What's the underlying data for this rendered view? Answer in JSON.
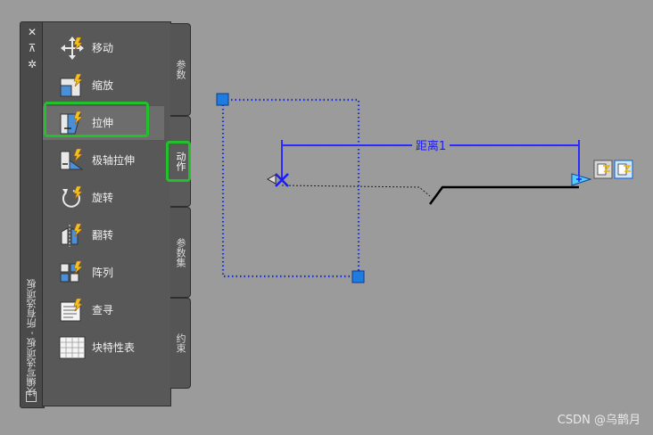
{
  "palette": {
    "title": "块编写选项板 - 所有选项板",
    "close_label": "✕",
    "pin_label": "⊼",
    "props_label": "✲",
    "tools": [
      {
        "label": "移动",
        "icon": "move-icon"
      },
      {
        "label": "缩放",
        "icon": "scale-icon"
      },
      {
        "label": "拉伸",
        "icon": "stretch-icon"
      },
      {
        "label": "极轴拉伸",
        "icon": "polar-stretch-icon"
      },
      {
        "label": "旋转",
        "icon": "rotate-icon"
      },
      {
        "label": "翻转",
        "icon": "flip-icon"
      },
      {
        "label": "阵列",
        "icon": "array-icon"
      },
      {
        "label": "查寻",
        "icon": "lookup-icon"
      },
      {
        "label": "块特性表",
        "icon": "block-table-icon"
      }
    ],
    "selected_tool": "拉伸",
    "tabs": [
      {
        "label": "参数"
      },
      {
        "label": "动作"
      },
      {
        "label": "参数集"
      },
      {
        "label": "约束"
      }
    ],
    "active_tab": "动作"
  },
  "drawing": {
    "dimension_label": "距离1"
  },
  "colors": {
    "highlight": "#22c02a",
    "grip": "#1e7be0",
    "dimension": "#2b2bff"
  },
  "watermark": "CSDN @乌鹊月"
}
